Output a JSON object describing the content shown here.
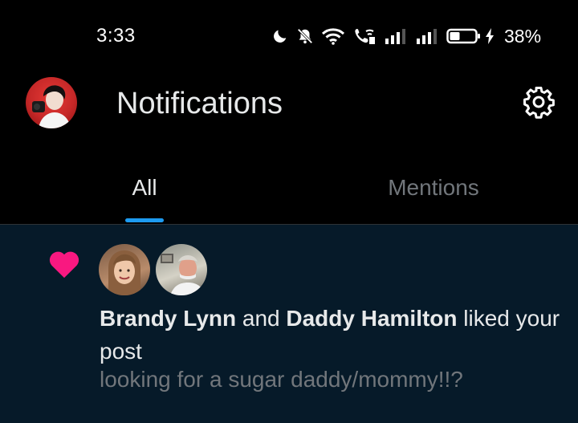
{
  "status_bar": {
    "time": "3:33",
    "icons": [
      "moon-icon",
      "bell-off-icon",
      "wifi-icon",
      "wifi-calling-icon",
      "signal-icon",
      "signal-icon",
      "battery-icon",
      "charging-bolt-icon"
    ],
    "battery_percent": "38%"
  },
  "header": {
    "title": "Notifications",
    "settings_icon": "gear-icon"
  },
  "tabs": [
    {
      "label": "All",
      "selected": true
    },
    {
      "label": "Mentions",
      "selected": false
    }
  ],
  "colors": {
    "accent": "#1d9bf0",
    "like": "#f91880",
    "selected_row_bg": "#061a29",
    "muted_text": "#71767b"
  },
  "notification": {
    "type_icon": "heart-icon",
    "user1": "Brandy Lynn",
    "conj": "and",
    "user2": "Daddy Hamilton",
    "action": "liked your post",
    "post_snippet": "looking for a sugar daddy/mommy!!?"
  }
}
